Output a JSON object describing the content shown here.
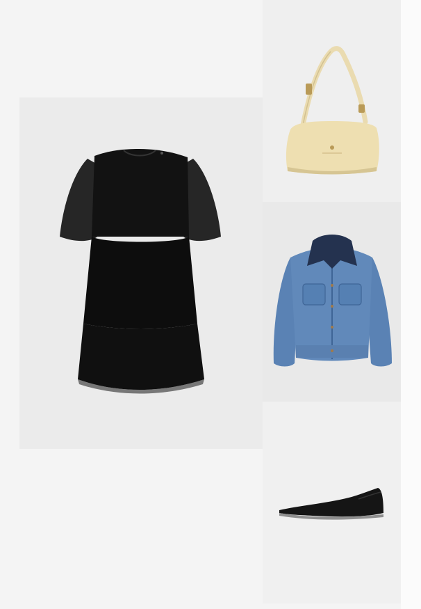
{
  "outfit": {
    "items": [
      {
        "id": "dress",
        "colors": {
          "background": "#ebebeb",
          "primary": "#121212",
          "shade": "#050505"
        }
      },
      {
        "id": "bag",
        "colors": {
          "background": "#efefef",
          "primary": "#eedfb1",
          "shade": "#d6c593",
          "hardware": "#b99a57"
        }
      },
      {
        "id": "jacket",
        "colors": {
          "background": "#e9e9e9",
          "primary": "#5f86b8",
          "shade": "#3f6596",
          "collar": "#24324f"
        }
      },
      {
        "id": "shoe",
        "colors": {
          "background": "#f0f0f0",
          "primary": "#151515",
          "sole": "#8f8f8f"
        }
      }
    ]
  }
}
